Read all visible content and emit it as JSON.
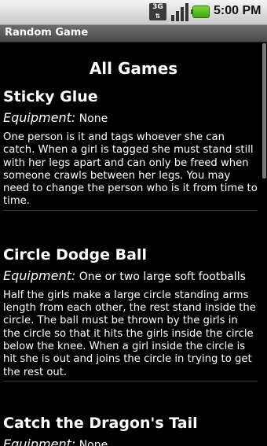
{
  "status_bar": {
    "network_label": "3G",
    "time": "5:00 PM"
  },
  "app": {
    "title": "Random Game"
  },
  "page": {
    "heading": "All Games"
  },
  "games": [
    {
      "title": "Sticky Glue",
      "equipment_label": "Equipment:",
      "equipment": "None",
      "description": "One person is it and tags whoever she can catch. When a girl is tagged she must stand still with her legs apart and can only be freed when someone crawls between her legs. You may need to change the person who is it from time to time."
    },
    {
      "title": "Circle Dodge Ball",
      "equipment_label": "Equipment:",
      "equipment": "One or two large soft footballs",
      "description": "Half the girls make a large circle standing arms length from each other, the rest stand inside the circle. The ball must be thrown by the girls in the circle so that it hits the girls inside the circle below the knee. When a girl inside the circle is hit she is out and joins the circle in trying to get the rest out."
    },
    {
      "title": "Catch the Dragon's Tail",
      "equipment_label": "Equipment:",
      "equipment": "None",
      "description": ""
    }
  ]
}
